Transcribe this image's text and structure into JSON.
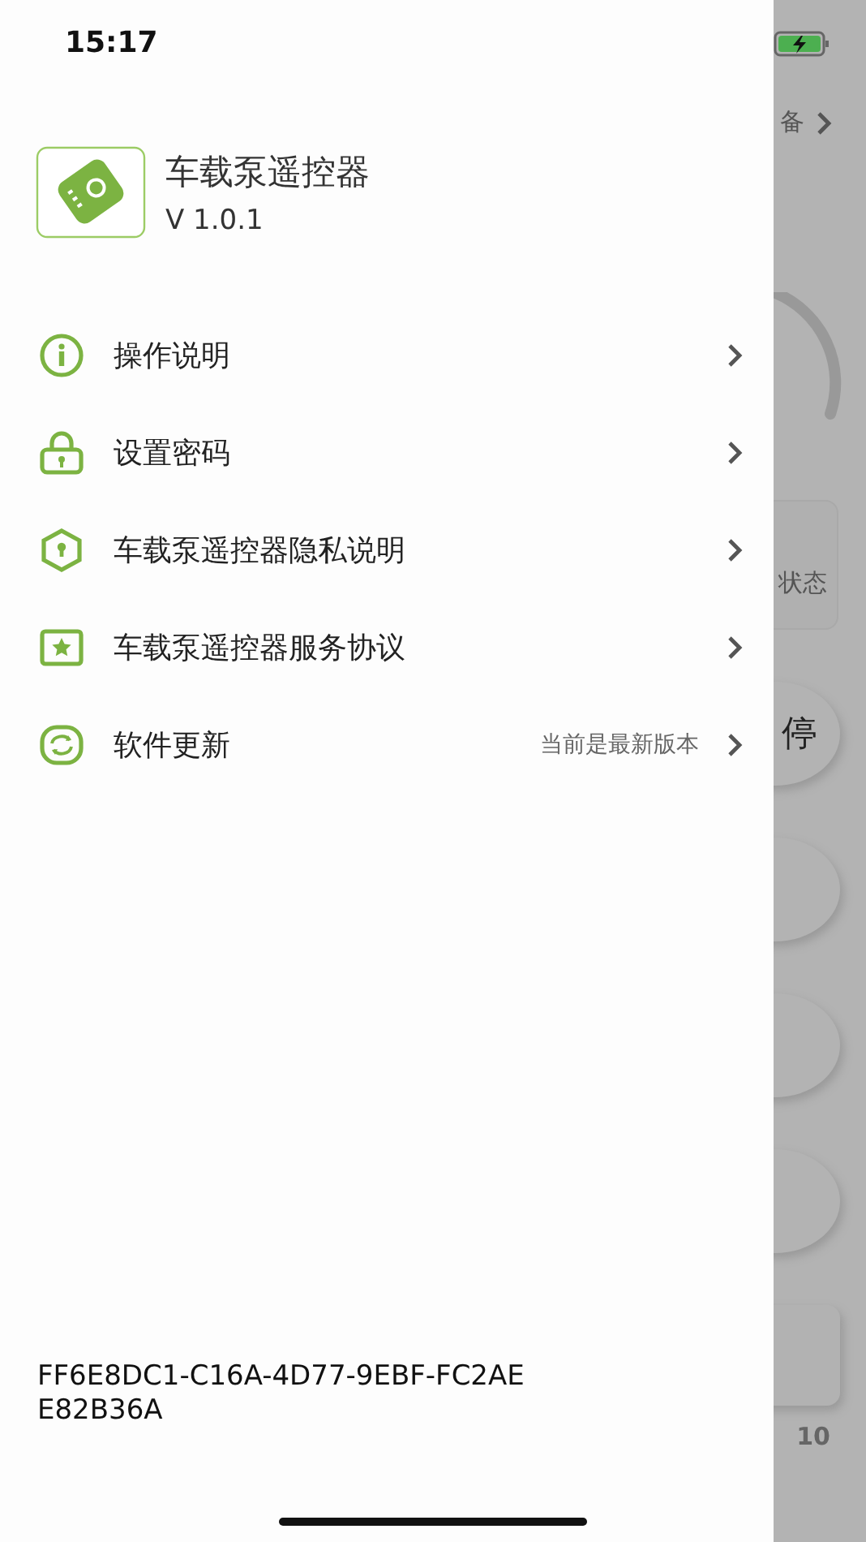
{
  "status_bar": {
    "time": "15:17"
  },
  "app": {
    "name": "车载泵遥控器",
    "version": "V 1.0.1"
  },
  "menu": [
    {
      "kind": "info",
      "label": "操作说明"
    },
    {
      "kind": "lock",
      "label": "设置密码"
    },
    {
      "kind": "shield",
      "label": "车载泵遥控器隐私说明"
    },
    {
      "kind": "star",
      "label": "车载泵遥控器服务协议"
    },
    {
      "kind": "update",
      "label": "软件更新",
      "detail": "当前是最新版本"
    }
  ],
  "device_id": "FF6E8DC1-C16A-4D77-9EBF-FC2AEE82B36A",
  "behind": {
    "top_text": "备",
    "card_text": "状态",
    "button_text": "停",
    "footer_text": "10"
  }
}
